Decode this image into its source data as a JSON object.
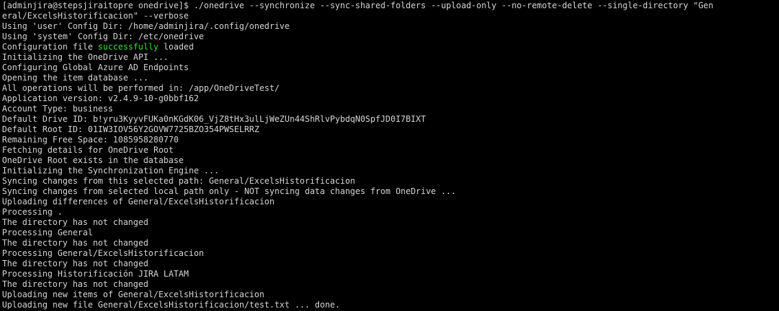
{
  "terminal": {
    "prompt": "[adminjira@stepsjiraitopre onedrive]$ ",
    "command": "./onedrive --synchronize --sync-shared-folders --upload-only --no-remote-delete --single-directory \"Gen",
    "command_wrap": "eral/ExcelsHistorificacion\" --verbose",
    "lines": [
      "Using 'user' Config Dir: /home/adminjira/.config/onedrive",
      "Using 'system' Config Dir: /etc/onedrive"
    ],
    "config_line": {
      "prefix": "Configuration file ",
      "highlight": "successfully",
      "suffix": " loaded"
    },
    "lines_after": [
      "Initializing the OneDrive API ...",
      "Configuring Global Azure AD Endpoints",
      "Opening the item database ...",
      "All operations will be performed in: /app/OneDriveTest/",
      "Application version: v2.4.9-10-g0bbf162",
      "Account Type: business",
      "Default Drive ID: b!yru3KyyvFUKa0nKGdK06_VjZ8tHx3ulLjWeZUn44ShRlvPybdqN0SpfJD0I7BIXT",
      "Default Root ID: 01IW3IOV56Y2GOVW7725BZO354PWSELRRZ",
      "Remaining Free Space: 1085958280770",
      "Fetching details for OneDrive Root",
      "OneDrive Root exists in the database",
      "Initializing the Synchronization Engine ...",
      "Syncing changes from this selected path: General/ExcelsHistorificacion",
      "Syncing changes from selected local path only - NOT syncing data changes from OneDrive ...",
      "Uploading differences of General/ExcelsHistorificacion",
      "Processing .",
      "The directory has not changed",
      "Processing General",
      "The directory has not changed",
      "Processing General/ExcelsHistorificacion",
      "The directory has not changed",
      "Processing Historificación JIRA LATAM",
      "The directory has not changed",
      "Uploading new items of General/ExcelsHistorificacion",
      "Uploading new file General/ExcelsHistorificacion/test.txt ... done."
    ]
  },
  "colors": {
    "background": "#000000",
    "text": "#d6d6d6",
    "success": "#34e234"
  }
}
